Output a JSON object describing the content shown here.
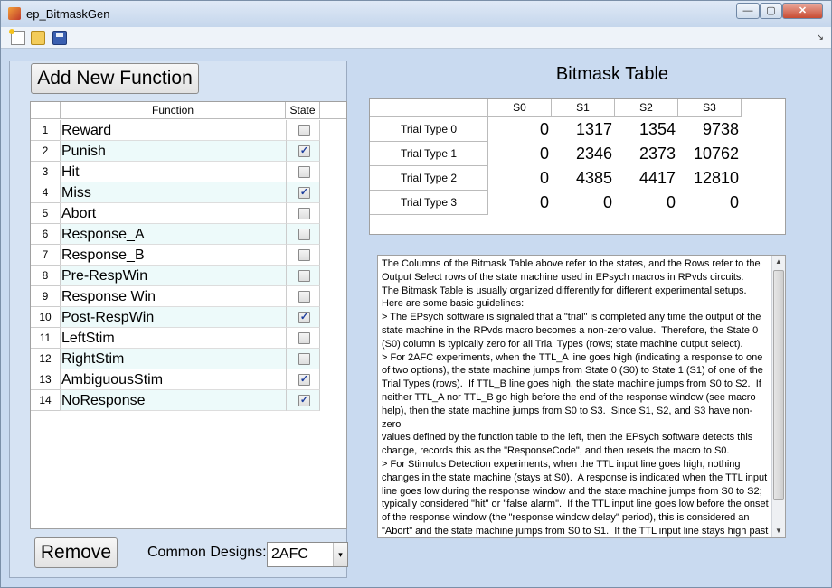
{
  "window": {
    "title": "ep_BitmaskGen",
    "minimize_symbol": "—",
    "maximize_symbol": "▢",
    "close_symbol": "✕"
  },
  "toolbar": {
    "icons": [
      "new-file-icon",
      "open-folder-icon",
      "save-icon"
    ],
    "dock_arrow": "↘"
  },
  "left": {
    "add_button_label": "Add New Function",
    "table": {
      "headers": {
        "function": "Function",
        "state": "State"
      },
      "rows": [
        {
          "num": "1",
          "name": "Reward",
          "checked": false
        },
        {
          "num": "2",
          "name": "Punish",
          "checked": true
        },
        {
          "num": "3",
          "name": "Hit",
          "checked": false
        },
        {
          "num": "4",
          "name": "Miss",
          "checked": true
        },
        {
          "num": "5",
          "name": "Abort",
          "checked": false
        },
        {
          "num": "6",
          "name": "Response_A",
          "checked": false
        },
        {
          "num": "7",
          "name": "Response_B",
          "checked": false
        },
        {
          "num": "8",
          "name": "Pre-RespWin",
          "checked": false
        },
        {
          "num": "9",
          "name": "Response Win",
          "checked": false
        },
        {
          "num": "10",
          "name": "Post-RespWin",
          "checked": true
        },
        {
          "num": "11",
          "name": "LeftStim",
          "checked": false
        },
        {
          "num": "12",
          "name": "RightStim",
          "checked": false
        },
        {
          "num": "13",
          "name": "AmbiguousStim",
          "checked": true
        },
        {
          "num": "14",
          "name": "NoResponse",
          "checked": true
        }
      ]
    },
    "remove_button_label": "Remove",
    "common_designs_label": "Common Designs:",
    "common_designs_value": "2AFC",
    "dropdown_arrow": "▾"
  },
  "bitmask": {
    "title": "Bitmask Table",
    "columns": [
      "S0",
      "S1",
      "S2",
      "S3"
    ],
    "rows": [
      {
        "label": "Trial Type 0",
        "values": [
          "0",
          "1317",
          "1354",
          "9738"
        ]
      },
      {
        "label": "Trial Type 1",
        "values": [
          "0",
          "2346",
          "2373",
          "10762"
        ]
      },
      {
        "label": "Trial Type 2",
        "values": [
          "0",
          "4385",
          "4417",
          "12810"
        ]
      },
      {
        "label": "Trial Type 3",
        "values": [
          "0",
          "0",
          "0",
          "0"
        ]
      }
    ]
  },
  "help": {
    "text": "The Columns of the Bitmask Table above refer to the states, and the Rows refer to the\nOutput Select rows of the state machine used in EPsych macros in RPvds circuits.\nThe Bitmask Table is usually organized differently for different experimental setups.\nHere are some basic guidelines:\n> The EPsych software is signaled that a \"trial\" is completed any time the output of the\nstate machine in the RPvds macro becomes a non-zero value.  Therefore, the State 0\n(S0) column is typically zero for all Trial Types (rows; state machine output select).\n> For 2AFC experiments, when the TTL_A line goes high (indicating a response to one\nof two options), the state machine jumps from State 0 (S0) to State 1 (S1) of one of the\nTrial Types (rows).  If TTL_B line goes high, the state machine jumps from S0 to S2.  If\nneither TTL_A nor TTL_B go high before the end of the response window (see macro\nhelp), then the state machine jumps from S0 to S3.  Since S1, S2, and S3 have non-zero\nvalues defined by the function table to the left, then the EPsych software detects this\nchange, records this as the \"ResponseCode\", and then resets the macro to S0.\n> For Stimulus Detection experiments, when the TTL input line goes high, nothing\nchanges in the state machine (stays at S0).  A response is indicated when the TTL input\nline goes low during the response window and the state machine jumps from S0 to S2;\ntypically considered \"hit\" or \"false alarm\".  If the TTL input line goes low before the onset\nof the response window (the \"response window delay\" period), this is considered an\n\"Abort\" and the state machine jumps from S0 to S1.  If the TTL input line stays high past\nwhen the response window ends (response window delay + response window"
  }
}
